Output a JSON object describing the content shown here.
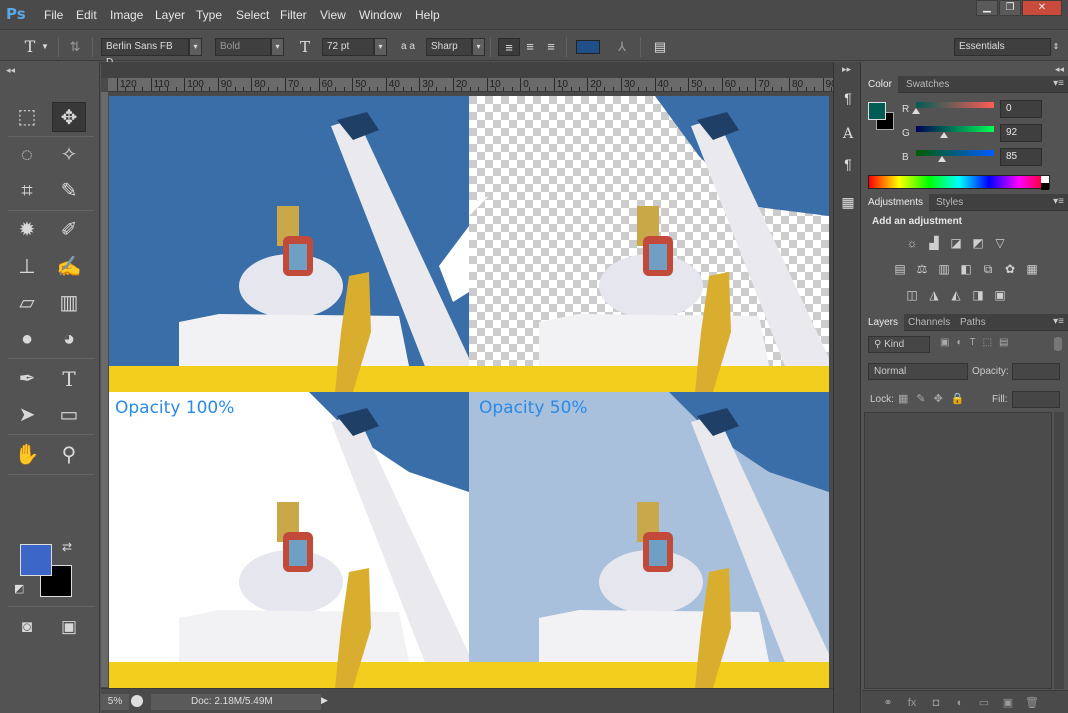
{
  "app": {
    "logo": "Ps",
    "menu": [
      "File",
      "Edit",
      "Image",
      "Layer",
      "Type",
      "Select",
      "Filter",
      "View",
      "Window",
      "Help"
    ],
    "window_controls": [
      "▁",
      "❐",
      "✕"
    ]
  },
  "options": {
    "tool_glyph": "T",
    "font_family": "Berlin Sans FB D...",
    "font_style": "Bold",
    "font_size": "72 pt",
    "aa_label": "a a",
    "anti_alias": "Sharp",
    "workspace": "Essentials",
    "text_color": "#1f4f86"
  },
  "toolbar": {
    "collapse": "◂◂",
    "tools": [
      {
        "icon": "marquee-icon",
        "glyph": "⬚"
      },
      {
        "icon": "move-icon",
        "glyph": "✥"
      },
      {
        "icon": "lasso-icon",
        "glyph": "◌"
      },
      {
        "icon": "magic-wand-icon",
        "glyph": "✧"
      },
      {
        "icon": "crop-icon",
        "glyph": "⌗"
      },
      {
        "icon": "eyedropper-icon",
        "glyph": "✎"
      },
      {
        "icon": "healing-brush-icon",
        "glyph": "✹"
      },
      {
        "icon": "brush-icon",
        "glyph": "✐"
      },
      {
        "icon": "clone-stamp-icon",
        "glyph": "⊥"
      },
      {
        "icon": "history-brush-icon",
        "glyph": "✍"
      },
      {
        "icon": "eraser-icon",
        "glyph": "▱"
      },
      {
        "icon": "gradient-icon",
        "glyph": "▥"
      },
      {
        "icon": "blur-icon",
        "glyph": "●"
      },
      {
        "icon": "dodge-icon",
        "glyph": "◕"
      },
      {
        "icon": "pen-icon",
        "glyph": "✒"
      },
      {
        "icon": "type-icon",
        "glyph": "T"
      },
      {
        "icon": "path-selection-icon",
        "glyph": "➤"
      },
      {
        "icon": "rectangle-icon",
        "glyph": "▭"
      },
      {
        "icon": "hand-icon",
        "glyph": "✋"
      },
      {
        "icon": "zoom-icon",
        "glyph": "⚲"
      }
    ],
    "foreground_color": "#3c66c8",
    "background_color": "#000000",
    "quick_mask_glyph": "◙",
    "screen_mode_glyph": "▣"
  },
  "ruler": {
    "labels": [
      "120",
      "110",
      "100",
      "90",
      "80",
      "70",
      "60",
      "50",
      "40",
      "30",
      "20",
      "10",
      "0",
      "10",
      "20",
      "30",
      "40",
      "50",
      "60",
      "70",
      "80",
      "90"
    ]
  },
  "canvas": {
    "label_100": "Opacity 100%",
    "label_50": "Opacity 50%",
    "sky_color": "#3a6ea8",
    "label_color": "#2a8ae6"
  },
  "status": {
    "zoom": "5%",
    "doc": "Doc: 2.18M/5.49M"
  },
  "color_panel": {
    "tabs": [
      "Color",
      "Swatches"
    ],
    "r_label": "R",
    "g_label": "G",
    "b_label": "B",
    "r": "0",
    "g": "92",
    "b": "85",
    "r_fraction": 0.0,
    "g_fraction": 0.361,
    "b_fraction": 0.333,
    "fg": "#005c55",
    "bg": "#000000"
  },
  "adjustments_panel": {
    "tabs": [
      "Adjustments",
      "Styles"
    ],
    "heading": "Add an adjustment",
    "icons": [
      [
        "brightness-icon",
        "levels-icon",
        "curves-icon",
        "exposure-icon",
        "gradient-map-icon"
      ],
      [
        "vibrance-icon",
        "hue-icon",
        "color-balance-icon",
        "bw-icon",
        "photo-filter-icon",
        "channel-mixer-icon",
        "color-lookup-icon"
      ],
      [
        "invert-icon",
        "posterize-icon",
        "threshold-icon",
        "selective-color-icon",
        "gradient-fill-icon"
      ]
    ],
    "glyphs": [
      [
        "☼",
        "▟",
        "◪",
        "◩",
        "▽"
      ],
      [
        "▤",
        "⚖",
        "▥",
        "◧",
        "⧉",
        "✿",
        "▦"
      ],
      [
        "◫",
        "◮",
        "◭",
        "◨",
        "▣"
      ]
    ]
  },
  "layers_panel": {
    "tabs": [
      "Layers",
      "Channels",
      "Paths"
    ],
    "kind": "Kind",
    "blend_mode": "Normal",
    "opacity_label": "Opacity:",
    "lock_label": "Lock:",
    "fill_label": "Fill:",
    "footer_icons": [
      "link-icon",
      "fx-icon",
      "mask-icon",
      "adjustment-layer-icon",
      "group-icon",
      "new-layer-icon",
      "trash-icon"
    ],
    "footer_glyphs": [
      "⚭",
      "fx",
      "◘",
      "◐",
      "▭",
      "▣",
      "🗑"
    ]
  }
}
